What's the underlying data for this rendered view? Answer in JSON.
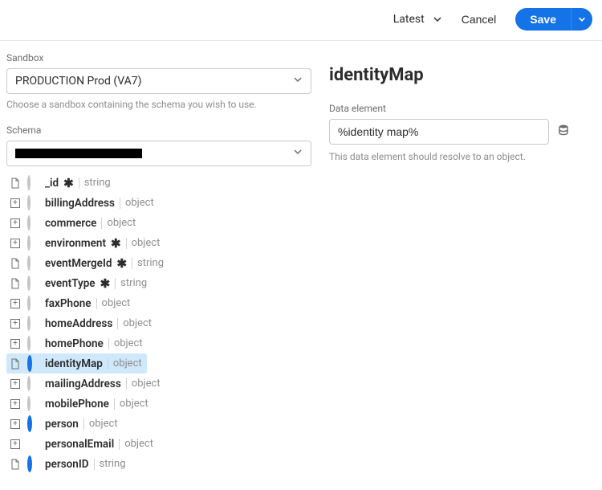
{
  "header": {
    "version_label": "Latest",
    "cancel_label": "Cancel",
    "save_label": "Save"
  },
  "sandbox": {
    "label": "Sandbox",
    "selected": "PRODUCTION Prod (VA7)",
    "help": "Choose a sandbox containing the schema you wish to use."
  },
  "schema": {
    "label": "Schema",
    "fields": [
      {
        "name": "_id",
        "type": "string",
        "required": true,
        "expandable": false,
        "radio": "off",
        "selected": false
      },
      {
        "name": "billingAddress",
        "type": "object",
        "required": false,
        "expandable": true,
        "radio": "off",
        "selected": false
      },
      {
        "name": "commerce",
        "type": "object",
        "required": false,
        "expandable": true,
        "radio": "off",
        "selected": false
      },
      {
        "name": "environment",
        "type": "object",
        "required": true,
        "expandable": true,
        "radio": "off",
        "selected": false
      },
      {
        "name": "eventMergeId",
        "type": "string",
        "required": true,
        "expandable": false,
        "radio": "off",
        "selected": false
      },
      {
        "name": "eventType",
        "type": "string",
        "required": true,
        "expandable": false,
        "radio": "off",
        "selected": false
      },
      {
        "name": "faxPhone",
        "type": "object",
        "required": false,
        "expandable": true,
        "radio": "off",
        "selected": false
      },
      {
        "name": "homeAddress",
        "type": "object",
        "required": false,
        "expandable": true,
        "radio": "off",
        "selected": false
      },
      {
        "name": "homePhone",
        "type": "object",
        "required": false,
        "expandable": true,
        "radio": "off",
        "selected": false
      },
      {
        "name": "identityMap",
        "type": "object",
        "required": false,
        "expandable": false,
        "radio": "blue",
        "selected": true
      },
      {
        "name": "mailingAddress",
        "type": "object",
        "required": false,
        "expandable": true,
        "radio": "off",
        "selected": false
      },
      {
        "name": "mobilePhone",
        "type": "object",
        "required": false,
        "expandable": true,
        "radio": "off",
        "selected": false
      },
      {
        "name": "person",
        "type": "object",
        "required": false,
        "expandable": true,
        "radio": "blue",
        "selected": false
      },
      {
        "name": "personalEmail",
        "type": "object",
        "required": false,
        "expandable": true,
        "radio": "half",
        "selected": false
      },
      {
        "name": "personID",
        "type": "string",
        "required": false,
        "expandable": false,
        "radio": "blue",
        "selected": false
      }
    ]
  },
  "panel": {
    "title": "identityMap",
    "data_element_label": "Data element",
    "data_element_value": "%identity map%",
    "help": "This data element should resolve to an object."
  }
}
